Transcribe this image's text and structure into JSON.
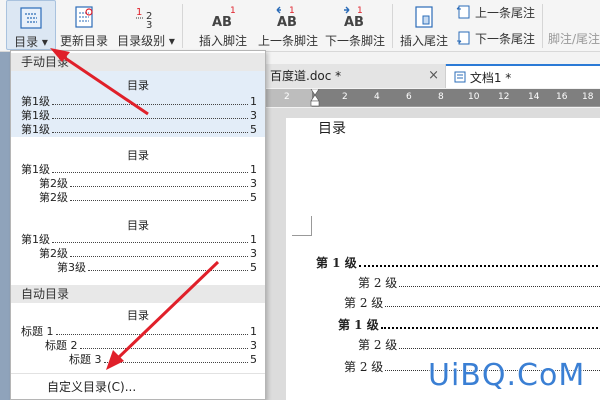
{
  "ribbon": {
    "toc_label": "目录",
    "update_toc_label": "更新目录",
    "toc_level_label": "目录级别",
    "insert_footnote_label": "插入脚注",
    "prev_footnote_label": "上一条脚注",
    "next_footnote_label": "下一条脚注",
    "insert_endnote_label": "插入尾注",
    "prev_endnote_label": "上一条尾注",
    "next_endnote_label": "下一条尾注",
    "footnote_endnote_label": "脚注/尾注",
    "ab_text": "AB",
    "one_text": "1"
  },
  "tabs": [
    {
      "label": "百度道.doc *",
      "close": "×"
    },
    {
      "label": "文档1 *"
    }
  ],
  "ruler": {
    "ticks": [
      "2",
      "2",
      "4",
      "6",
      "8",
      "10",
      "12",
      "14",
      "16",
      "18"
    ]
  },
  "dropdown": {
    "manual_header": "手动目录",
    "auto_header": "自动目录",
    "previews": [
      {
        "title": "目录",
        "lines": [
          {
            "text": "第1级",
            "page": "1"
          },
          {
            "text": "第1级",
            "page": "3"
          },
          {
            "text": "第1级",
            "page": "5"
          }
        ]
      },
      {
        "title": "目录",
        "lines": [
          {
            "text": "第1级",
            "page": "1"
          },
          {
            "text": "第2级",
            "page": "3"
          },
          {
            "text": "第2级",
            "page": "5"
          }
        ]
      },
      {
        "title": "目录",
        "lines": [
          {
            "text": "第1级",
            "page": "1"
          },
          {
            "text": "第2级",
            "page": "3"
          },
          {
            "text": "第3级",
            "page": "5"
          }
        ]
      },
      {
        "title": "目录",
        "lines": [
          {
            "text": "标题 1",
            "page": "1"
          },
          {
            "text": "标题 2",
            "page": "3"
          },
          {
            "text": "标题 3",
            "page": "5"
          }
        ]
      }
    ],
    "custom_label": "自定义目录(C)..."
  },
  "document": {
    "title": "目录",
    "lines": [
      {
        "text": "第 1 级"
      },
      {
        "text": "第 2 级"
      },
      {
        "text": "第 2 级"
      },
      {
        "text": "第 1 级"
      },
      {
        "text": "第 2 级"
      },
      {
        "text": "第 2 级"
      }
    ]
  },
  "watermark": "UiBQ.CoM",
  "colors": {
    "accent": "#2b7ad6",
    "arrow": "#e0202a",
    "hover": "#e3edf8"
  }
}
